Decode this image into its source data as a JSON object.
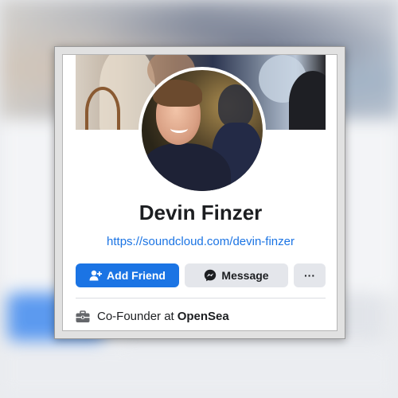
{
  "profile": {
    "name": "Devin Finzer",
    "website": "https://soundcloud.com/devin-finzer",
    "work_prefix": "Co-Founder at",
    "work_company": "OpenSea"
  },
  "actions": {
    "add_friend_label": "Add Friend",
    "message_label": "Message",
    "more_label": "···"
  },
  "icons": {
    "add_friend": "add-friend-icon",
    "message": "messenger-icon",
    "more": "more-icon",
    "work": "briefcase-icon"
  },
  "colors": {
    "primary": "#1b74e4",
    "secondary_button": "#e4e6eb",
    "text": "#1c1e21"
  }
}
